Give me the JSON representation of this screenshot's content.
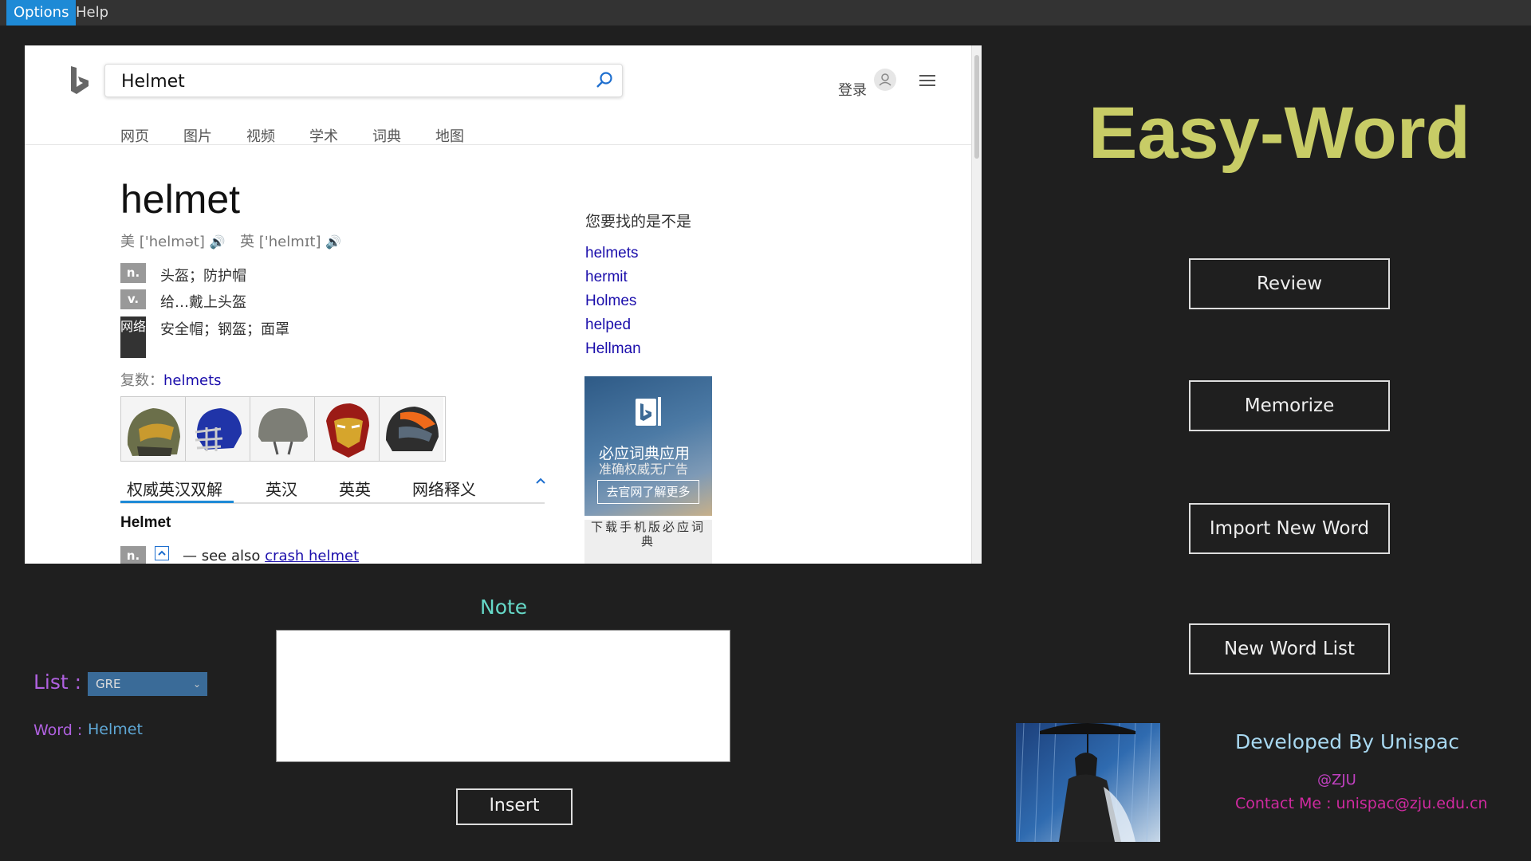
{
  "menu": {
    "items": [
      "Options",
      "Help"
    ]
  },
  "browser": {
    "search_value": "Helmet",
    "login": "登录",
    "tabs": [
      "网页",
      "图片",
      "视频",
      "学术",
      "词典",
      "地图"
    ],
    "headword": "helmet",
    "pron_us_label": "美",
    "pron_us": "['helmət]",
    "pron_uk_label": "英",
    "pron_uk": "['helmɪt]",
    "definitions": [
      {
        "pos": "n.",
        "text": "头盔；防护帽"
      },
      {
        "pos": "v.",
        "text": "给…戴上头盔"
      },
      {
        "pos": "网络",
        "text": "安全帽；钢盔；面罩"
      }
    ],
    "plural_label": "复数：",
    "plural_word": "helmets",
    "images": [
      "halo-helmet-image",
      "football-helmet-image",
      "military-helmet-image",
      "iron-man-helmet-image",
      "motorcycle-helmet-image"
    ],
    "subtabs": [
      "权威英汉双解",
      "英汉",
      "英英",
      "网络释义"
    ],
    "sense_head": "Helmet",
    "sense_pos": "n.",
    "see_also_prefix": "— see also",
    "see_also_link": "crash helmet",
    "suggest_title": "您要找的是不是",
    "suggestions": [
      "helmets",
      "hermit",
      "Holmes",
      "helped",
      "Hellman"
    ],
    "ad": {
      "title": "必应词典应用",
      "subtitle": "准确权威无广告",
      "button": "去官网了解更多",
      "bottom": "下载手机版必应词典"
    }
  },
  "app": {
    "title": "Easy-Word",
    "title_color": "#c8cc66",
    "buttons": [
      "Review",
      "Memorize",
      "Import New Word",
      "New Word List"
    ],
    "developer": "Developed By Unispac",
    "org": "@ZJU",
    "contact": "Contact Me : unispac@zju.edu.cn"
  },
  "note": {
    "label": "Note",
    "value": "",
    "insert": "Insert"
  },
  "list": {
    "label": "List :",
    "selected": "GRE",
    "word_label": "Word :",
    "word_value": "Helmet"
  }
}
